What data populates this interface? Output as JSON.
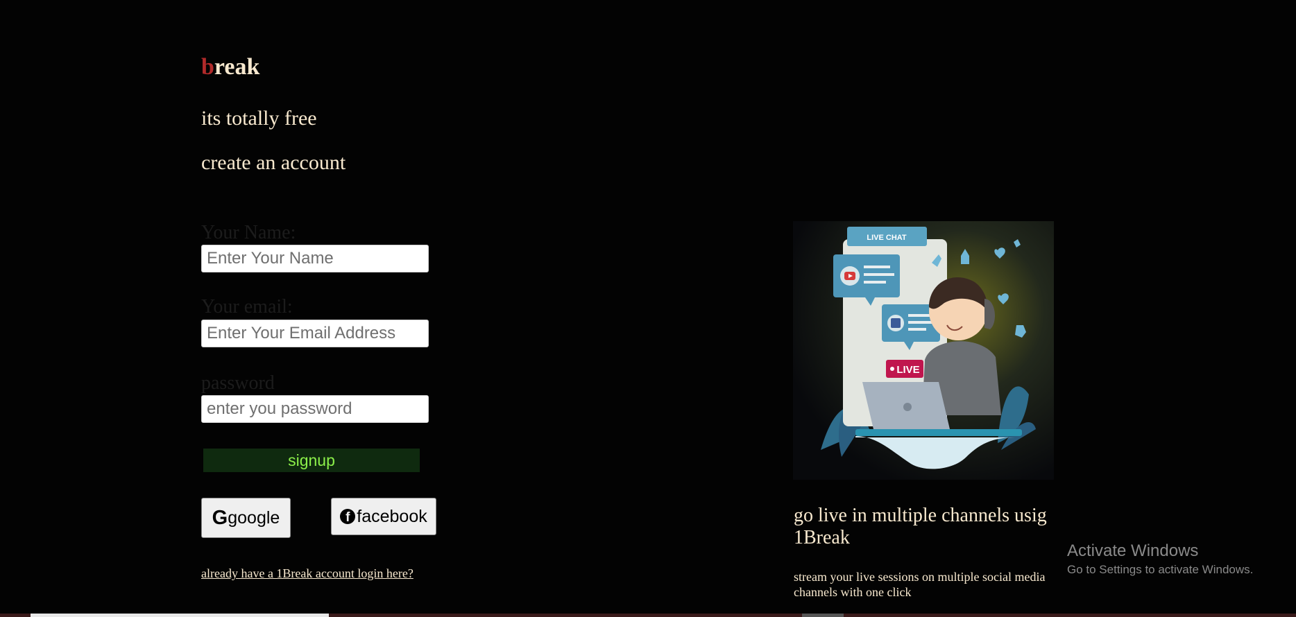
{
  "brand": {
    "first_letter": "b",
    "rest": "reak"
  },
  "colors": {
    "background": "#030303",
    "text": "#f8e9cf",
    "brand_accent": "#b02a2a",
    "signup_bg": "#0f2a0f",
    "signup_text": "#8cf04a"
  },
  "hero": {
    "tagline": "its totally free",
    "subtitle": "create an account"
  },
  "form": {
    "name": {
      "label": "Your Name:",
      "placeholder": "Enter Your Name"
    },
    "email": {
      "label": "Your email:",
      "placeholder": "Enter Your Email Address"
    },
    "password": {
      "label": "password",
      "placeholder": "enter you password"
    },
    "signup_label": "signup"
  },
  "social": {
    "google": {
      "icon": "google-icon",
      "glyph": "G",
      "label": "google"
    },
    "facebook": {
      "icon": "facebook-icon",
      "glyph": "f",
      "label": "facebook"
    }
  },
  "login_link": "already have a 1Break account login here?",
  "promo": {
    "image": {
      "live_chat_label": "LIVE CHAT",
      "live_badge": "LIVE"
    },
    "title": "go live in multiple channels usig 1Break",
    "description": "stream your live sessions on multiple social media channels with one click"
  },
  "watermark": {
    "title": "Activate Windows",
    "subtitle": "Go to Settings to activate Windows."
  }
}
